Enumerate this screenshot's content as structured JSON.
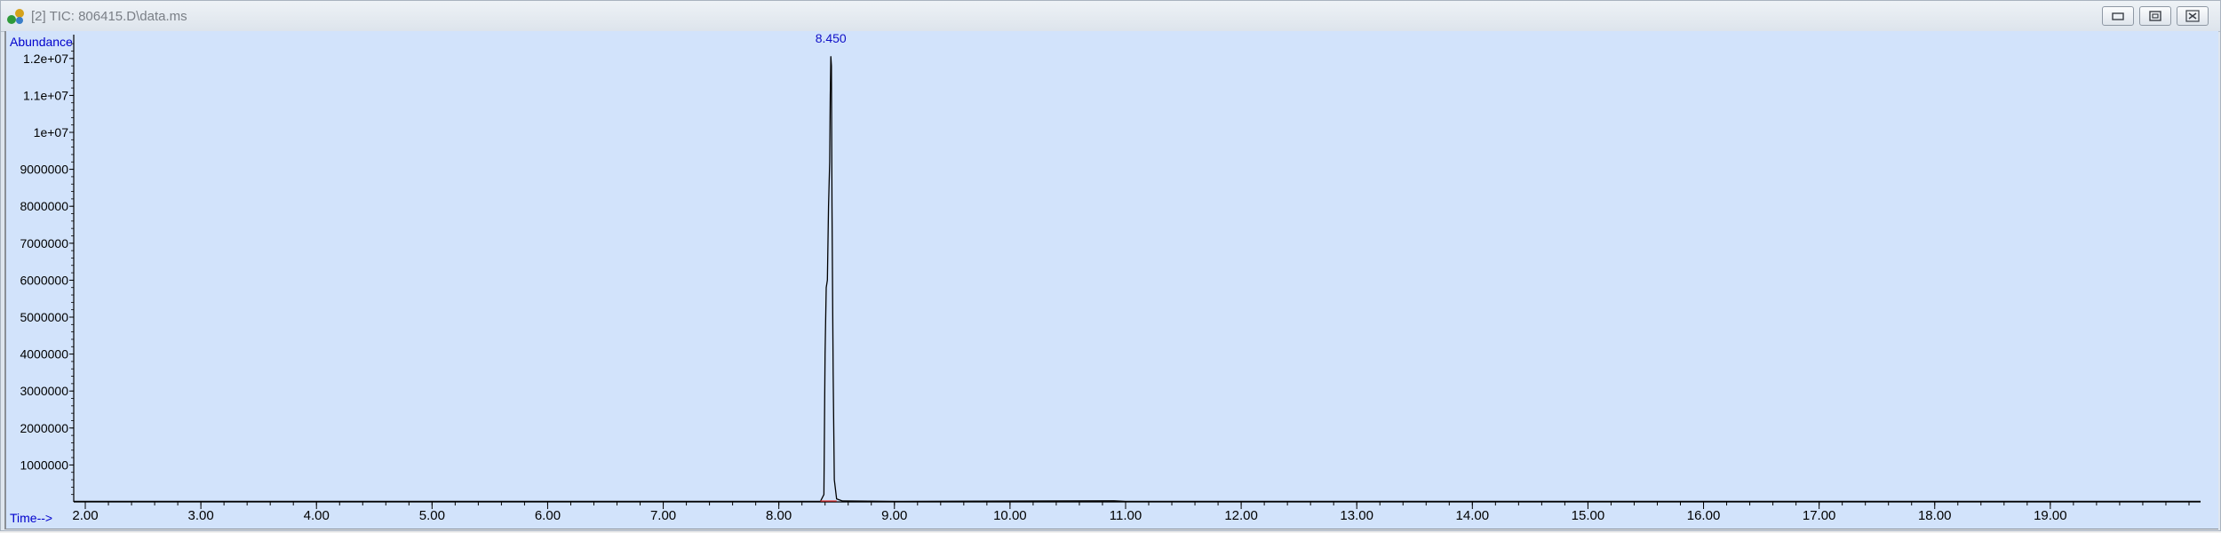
{
  "window": {
    "title": "[2] TIC: 806415.D\\data.ms",
    "buttons": [
      {
        "name": "minimize-button",
        "icon": "minimize-icon"
      },
      {
        "name": "restore-button",
        "icon": "restore-icon"
      },
      {
        "name": "close-button",
        "icon": "close-icon"
      }
    ]
  },
  "colors": {
    "plot_background": "#d2e3fb",
    "trace": "#000000",
    "peak_label": "#1010c8",
    "axis_label": "#0000cc",
    "baseline_marker": "#e03030"
  },
  "chart_data": {
    "type": "line",
    "ylabel": "Abundance",
    "xlabel": "Time-->",
    "x_ticks": [
      "2.00",
      "3.00",
      "4.00",
      "5.00",
      "6.00",
      "7.00",
      "8.00",
      "9.00",
      "10.00",
      "11.00",
      "12.00",
      "13.00",
      "14.00",
      "15.00",
      "16.00",
      "17.00",
      "18.00",
      "19.00"
    ],
    "y_ticks": [
      "1000000",
      "2000000",
      "3000000",
      "4000000",
      "5000000",
      "6000000",
      "7000000",
      "8000000",
      "9000000",
      "1e+07",
      "1.1e+07",
      "1.2e+07"
    ],
    "xlim": [
      1.9,
      20.3
    ],
    "ylim": [
      0,
      12500000
    ],
    "grid": false,
    "annotations": [
      {
        "x": 8.45,
        "text": "8.450"
      }
    ],
    "series": [
      {
        "points": [
          [
            1.9,
            15000
          ],
          [
            5.0,
            15000
          ],
          [
            8.36,
            15000
          ],
          [
            8.39,
            200000
          ],
          [
            8.4,
            4000000
          ],
          [
            8.41,
            5800000
          ],
          [
            8.42,
            6000000
          ],
          [
            8.43,
            8000000
          ],
          [
            8.44,
            9200000
          ],
          [
            8.445,
            11000000
          ],
          [
            8.45,
            12050000
          ],
          [
            8.455,
            11800000
          ],
          [
            8.46,
            8000000
          ],
          [
            8.47,
            3500000
          ],
          [
            8.48,
            600000
          ],
          [
            8.5,
            80000
          ],
          [
            8.55,
            25000
          ],
          [
            9.0,
            15000
          ],
          [
            10.9,
            30000
          ],
          [
            11.0,
            15000
          ],
          [
            20.3,
            15000
          ]
        ]
      }
    ]
  }
}
